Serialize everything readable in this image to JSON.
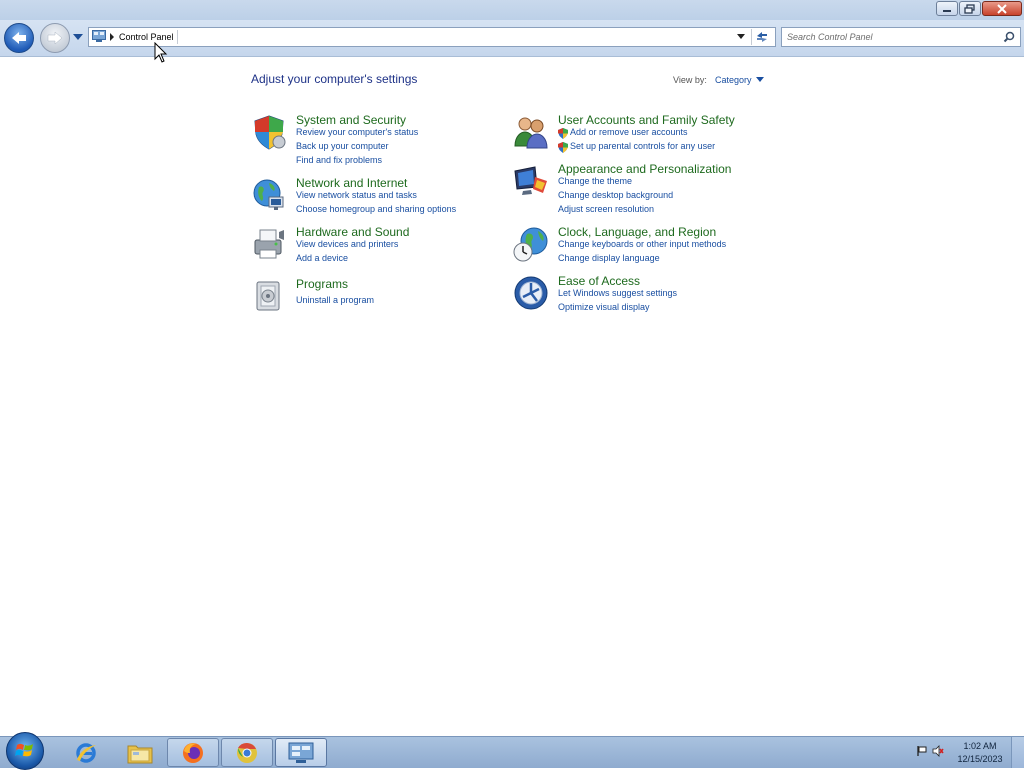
{
  "window": {
    "caption_buttons": {
      "minimize": "minimize",
      "maximize": "maximize",
      "close": "close"
    }
  },
  "navigation": {
    "breadcrumb": [
      "Control Panel"
    ],
    "search_placeholder": "Search Control Panel"
  },
  "main": {
    "heading": "Adjust your computer's settings",
    "view_by_label": "View by:",
    "view_by_value": "Category",
    "categories_left": [
      {
        "title": "System and Security",
        "icon": "shield-icon",
        "links": [
          "Review your computer's status",
          "Back up your computer",
          "Find and fix problems"
        ]
      },
      {
        "title": "Network and Internet",
        "icon": "network-globe-icon",
        "links": [
          "View network status and tasks",
          "Choose homegroup and sharing options"
        ]
      },
      {
        "title": "Hardware and Sound",
        "icon": "printer-icon",
        "links": [
          "View devices and printers",
          "Add a device"
        ]
      },
      {
        "title": "Programs",
        "icon": "programs-icon",
        "links": [
          "Uninstall a program"
        ]
      }
    ],
    "categories_right": [
      {
        "title": "User Accounts and Family Safety",
        "icon": "users-icon",
        "links": [
          "Add or remove user accounts",
          "Set up parental controls for any user"
        ]
      },
      {
        "title": "Appearance and Personalization",
        "icon": "monitor-icon",
        "links": [
          "Change the theme",
          "Change desktop background",
          "Adjust screen resolution"
        ]
      },
      {
        "title": "Clock, Language, and Region",
        "icon": "globe-clock-icon",
        "links": [
          "Change keyboards or other input methods",
          "Change display language"
        ]
      },
      {
        "title": "Ease of Access",
        "icon": "ease-of-access-icon",
        "links": [
          "Let Windows suggest settings",
          "Optimize visual display"
        ]
      }
    ]
  },
  "taskbar": {
    "items": [
      "start-orb",
      "internet-explorer",
      "windows-explorer",
      "firefox",
      "chrome",
      "control-panel"
    ],
    "clock_time": "1:02 AM",
    "clock_date": "12/15/2023"
  },
  "colors": {
    "category_title": "#1e6a1e",
    "link": "#1a4fa1",
    "heading": "#1e3287"
  }
}
